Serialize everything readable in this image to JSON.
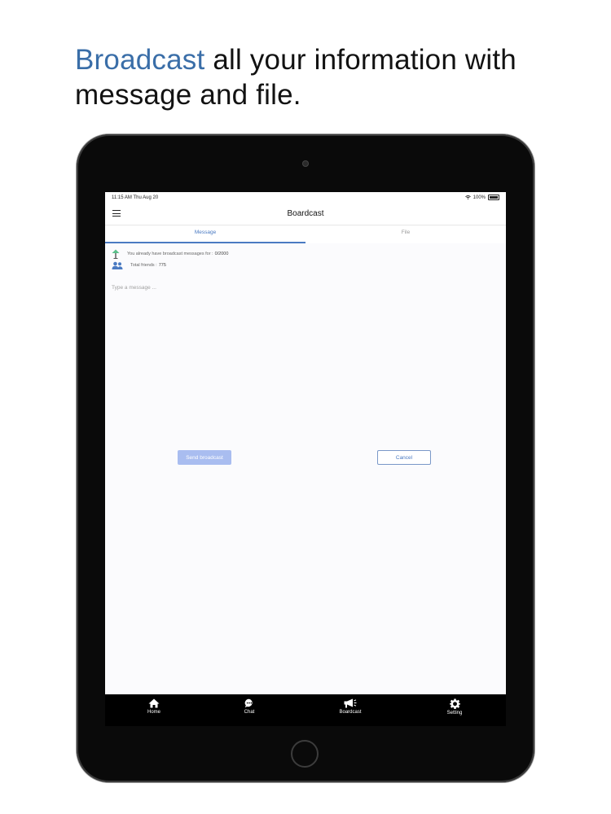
{
  "headline": {
    "accent": "Broadcast",
    "rest": " all your information with message and file."
  },
  "statusbar": {
    "time": "11:15 AM  Thu Aug 20",
    "battery": "100%"
  },
  "navbar": {
    "title": "Boardcast"
  },
  "tabs": [
    {
      "label": "Message"
    },
    {
      "label": "File"
    }
  ],
  "info": {
    "broadcast_label": "You already have broadcast messages for :",
    "broadcast_count": "0/2000",
    "friends_label": "Total friends :",
    "friends_count": "775"
  },
  "message": {
    "placeholder": "Type a message ..."
  },
  "buttons": {
    "send": "Send broadcast",
    "cancel": "Cancel"
  },
  "tabbar": [
    {
      "label": "Home",
      "icon": "home-icon"
    },
    {
      "label": "Chat",
      "icon": "chat-bubble-icon"
    },
    {
      "label": "Boardcast",
      "icon": "megaphone-icon"
    },
    {
      "label": "Setting",
      "icon": "gear-icon"
    }
  ],
  "colors": {
    "accent": "#3a6ea8",
    "tab_active": "#4a7ac2",
    "send_button": "#a9bdf0",
    "tabbar_bg": "#000000"
  }
}
